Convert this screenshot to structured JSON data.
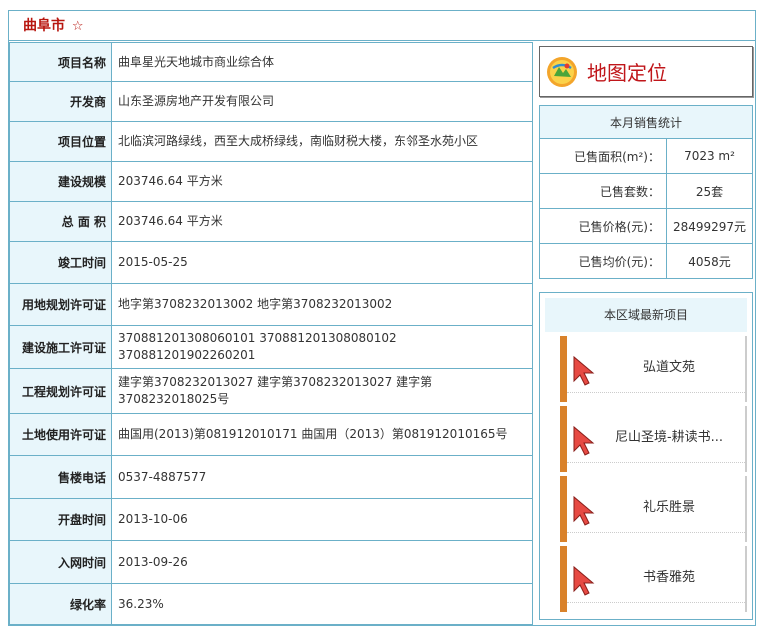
{
  "header": {
    "title": "曲阜市",
    "star": "☆"
  },
  "info_rows": [
    {
      "label": "项目名称",
      "value": "曲阜星光天地城市商业综合体"
    },
    {
      "label": "开发商",
      "value": "山东圣源房地产开发有限公司"
    },
    {
      "label": "项目位置",
      "value": "北临滨河路绿线，西至大成桥绿线，南临财税大楼，东邻圣水苑小区"
    },
    {
      "label": "建设规模",
      "value": "203746.64 平方米"
    },
    {
      "label": "总 面 积",
      "value": "203746.64 平方米"
    },
    {
      "label": "竣工时间",
      "value": "2015-05-25"
    },
    {
      "label": "用地规划许可证",
      "value": "地字第3708232013002 地字第3708232013002"
    },
    {
      "label": "建设施工许可证",
      "value": "370881201308060101 370881201308080102 370881201902260201"
    },
    {
      "label": "工程规划许可证",
      "value": "建字第3708232013027 建字第3708232013027 建字第3708232018025号"
    },
    {
      "label": "土地使用许可证",
      "value": "曲国用(2013)第081912010171 曲国用（2013）第081912010165号"
    },
    {
      "label": "售楼电话",
      "value": "0537-4887577"
    },
    {
      "label": "开盘时间",
      "value": "2013-10-06"
    },
    {
      "label": "入网时间",
      "value": "2013-09-26"
    },
    {
      "label": "绿化率",
      "value": "36.23%"
    }
  ],
  "map_button": {
    "label": "地图定位",
    "icon": "map-location-icon"
  },
  "sales_stats": {
    "title": "本月销售统计",
    "rows": [
      {
        "label": "已售面积(m²)：",
        "value": "7023 m²"
      },
      {
        "label": "已售套数：",
        "value": "25套"
      },
      {
        "label": "已售价格(元)：",
        "value": "28499297元"
      },
      {
        "label": "已售均价(元)：",
        "value": "4058元"
      }
    ]
  },
  "region_projects": {
    "title": "本区域最新项目",
    "items": [
      "弘道文苑",
      "尼山圣境-耕读书...",
      "礼乐胜景",
      "书香雅苑"
    ],
    "icon": "cursor-arrow-icon"
  },
  "colors": {
    "border": "#6bb0c8",
    "label_bg": "#e8f6fb",
    "title": "#b8160f",
    "map_text": "#c0161a"
  }
}
